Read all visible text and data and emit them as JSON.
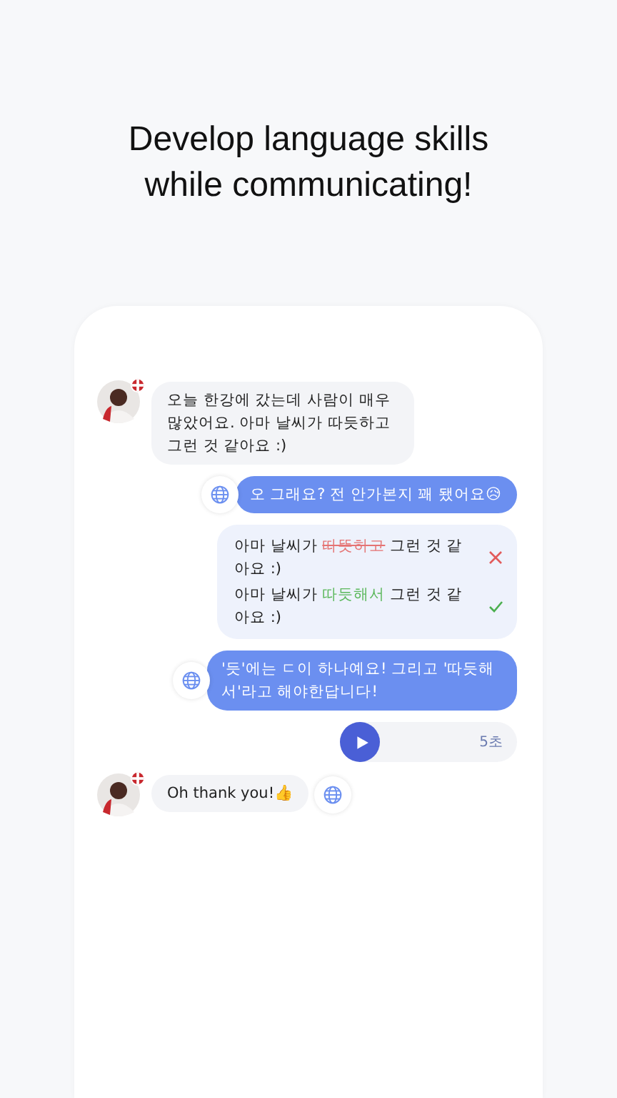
{
  "headline": "Develop language skills\nwhile communicating!",
  "messages": [
    {
      "kind": "received",
      "text": "오늘 한강에 갔는데 사람이 매우 많았어요. 아마 날씨가 따듯하고 그런 것 같아요 :)"
    },
    {
      "kind": "sent",
      "text": "오 그래요? 전 안가본지 꽤 됐어요😥"
    },
    {
      "kind": "correction",
      "lines": [
        {
          "kind": "wrong",
          "parts": [
            {
              "kind": "plain",
              "text": "아마 날씨가 "
            },
            {
              "kind": "wrong",
              "text": "따뜻하고"
            },
            {
              "kind": "plain",
              "text": " 그런 것 같아요 :)"
            }
          ]
        },
        {
          "kind": "right",
          "parts": [
            {
              "kind": "plain",
              "text": "아마 날씨가 "
            },
            {
              "kind": "right",
              "text": "따듯해서"
            },
            {
              "kind": "plain",
              "text": " 그런 것 같아요 :)"
            }
          ]
        }
      ]
    },
    {
      "kind": "sent",
      "text": "'듯'에는 ㄷ이 하나예요! 그리고 '따듯해서'라고 해야한답니다!"
    },
    {
      "kind": "audio",
      "duration": "5초"
    },
    {
      "kind": "received",
      "text": "Oh thank you!👍",
      "translate": true
    }
  ]
}
